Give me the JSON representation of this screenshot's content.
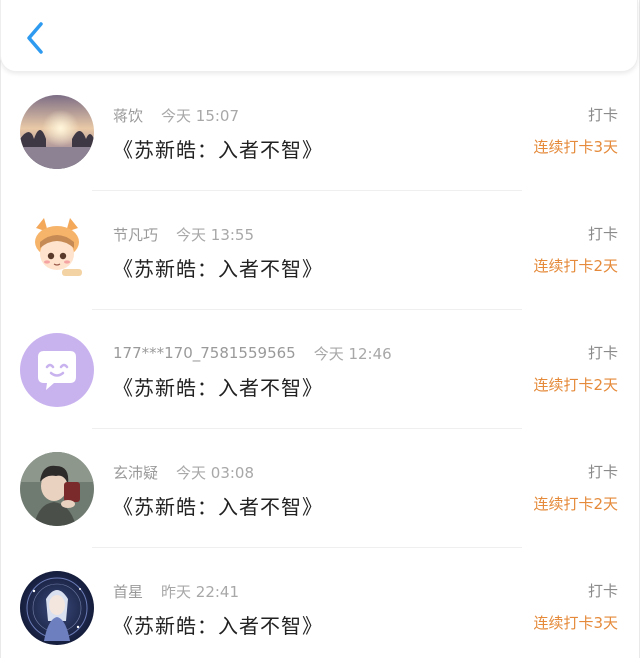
{
  "header": {
    "back_icon": "chevron-left-icon",
    "accent": "#2f9bf0"
  },
  "colors": {
    "streak": "#e58a3a",
    "meta": "#9a9a9a",
    "content": "#222222"
  },
  "entries": [
    {
      "name": "蒋饮",
      "time": "今天 15:07",
      "content": "《苏新皓：入者不智》",
      "action": "打卡",
      "streak": "连续打卡3天",
      "avatar": "sunset-landscape-avatar"
    },
    {
      "name": "节凡巧",
      "time": "今天 13:55",
      "content": "《苏新皓：入者不智》",
      "action": "打卡",
      "streak": "连续打卡2天",
      "avatar": "cartoon-chibi-avatar"
    },
    {
      "name": "177***170_7581559565",
      "time": "今天 12:46",
      "content": "《苏新皓：入者不智》",
      "action": "打卡",
      "streak": "连续打卡2天",
      "avatar": "default-chat-avatar"
    },
    {
      "name": "玄沛疑",
      "time": "今天 03:08",
      "content": "《苏新皓：入者不智》",
      "action": "打卡",
      "streak": "连续打卡2天",
      "avatar": "portrait-avatar"
    },
    {
      "name": "首星",
      "time": "昨天 22:41",
      "content": "《苏新皓：入者不智》",
      "action": "打卡",
      "streak": "连续打卡3天",
      "avatar": "anime-character-avatar"
    }
  ]
}
